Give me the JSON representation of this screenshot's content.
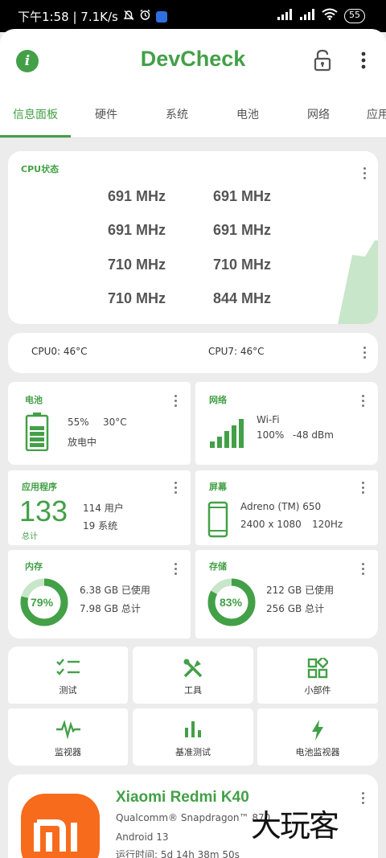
{
  "status_bar": {
    "time_info": "下午1:58 | 7.1K/s",
    "battery": "55"
  },
  "app": {
    "title": "DevCheck",
    "tabs": [
      "信息面板",
      "硬件",
      "系统",
      "电池",
      "网络",
      "应用"
    ]
  },
  "cpu_status": {
    "title": "CPU状态",
    "frequencies": [
      "691 MHz",
      "691 MHz",
      "691 MHz",
      "691 MHz",
      "710 MHz",
      "710 MHz",
      "710 MHz",
      "844 MHz"
    ]
  },
  "temps": {
    "cpu0": "CPU0: 46°C",
    "cpu7": "CPU7: 46°C"
  },
  "battery": {
    "title": "电池",
    "level": "55%",
    "temp": "30°C",
    "status": "放电中"
  },
  "network": {
    "title": "网络",
    "type": "Wi-Fi",
    "strength": "100%",
    "dbm": "-48 dBm"
  },
  "apps": {
    "title": "应用程序",
    "total": "133",
    "total_label": "总计",
    "user": "114 用户",
    "system": "19 系统"
  },
  "screen": {
    "title": "屏幕",
    "gpu": "Adreno (TM) 650",
    "resolution": "2400 x 1080",
    "refresh": "120Hz"
  },
  "memory": {
    "title": "内存",
    "percent": "79%",
    "used_fraction": 0.79,
    "used": "6.38 GB 已使用",
    "total": "7.98 GB 总计"
  },
  "storage": {
    "title": "存储",
    "percent": "83%",
    "used_fraction": 0.83,
    "used": "212 GB 已使用",
    "total": "256 GB 总计"
  },
  "tools": [
    {
      "label": "测试",
      "icon": "checklist-icon"
    },
    {
      "label": "工具",
      "icon": "tools-icon"
    },
    {
      "label": "小部件",
      "icon": "widgets-icon"
    },
    {
      "label": "监视器",
      "icon": "pulse-icon"
    },
    {
      "label": "基准测试",
      "icon": "bar-chart-icon"
    },
    {
      "label": "电池监视器",
      "icon": "lightning-icon"
    }
  ],
  "device": {
    "name": "Xiaomi Redmi K40",
    "soc": "Qualcomm® Snapdragon™ 870",
    "os": "Android 13",
    "uptime": "运行时间: 5d 14h 38m 50s"
  },
  "watermark": "大玩客",
  "colors": {
    "accent": "#43a047",
    "accent_light": "#c8e6c9",
    "brand_orange": "#f76b1c"
  }
}
